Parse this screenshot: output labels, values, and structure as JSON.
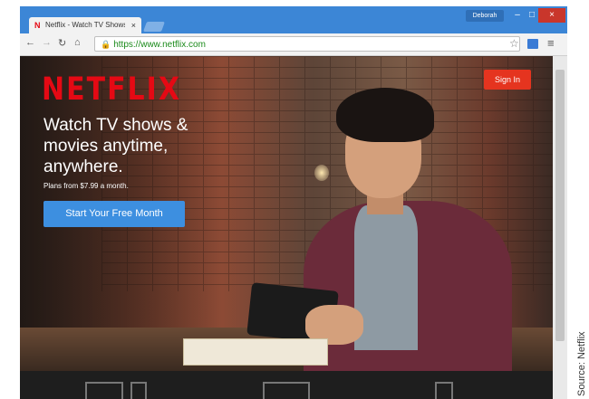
{
  "browser": {
    "tab_title": "Netflix - Watch TV Shows",
    "tab_close": "×",
    "user_label": "Deborah",
    "window_controls": {
      "minimize": "–",
      "maximize": "□",
      "close": "×"
    },
    "url": "https://www.netflix.com",
    "icons": {
      "back": "back-arrow-icon",
      "forward": "forward-arrow-icon",
      "reload": "reload-icon",
      "home": "home-icon",
      "lock": "lock-icon",
      "star": "bookmark-star-icon",
      "menu": "hamburger-menu-icon"
    }
  },
  "page": {
    "logo": "NETFLIX",
    "sign_in": "Sign In",
    "headline": "Watch TV shows & movies anytime, anywhere.",
    "plans": "Plans from $7.99 a month.",
    "cta": "Start Your Free Month"
  },
  "caption": "Source: Netflix",
  "colors": {
    "brand": "#e50914",
    "cta": "#3d8fe0",
    "chrome": "#3c86d6"
  }
}
